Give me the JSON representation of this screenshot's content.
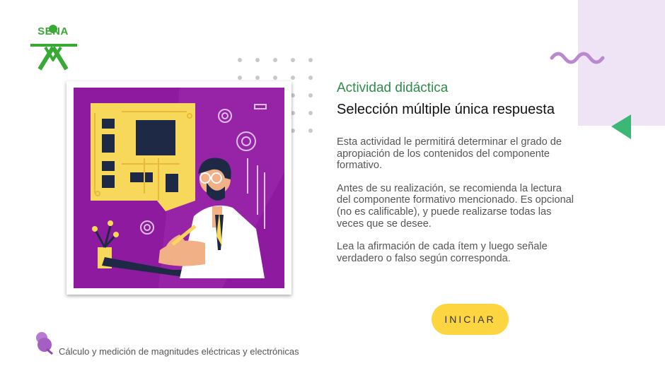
{
  "logo": {
    "text": "SENA"
  },
  "activity": {
    "subtitle": "Actividad didáctica",
    "title": "Selección múltiple única respuesta",
    "paragraphs": [
      "Esta actividad le permitirá determinar el grado de apropiación de los contenidos del componente formativo.",
      "Antes de su realización, se recomienda la lectura del componente formativo mencionado. Es opcional (no es calificable), y puede realizarse todas las veces que se desee.",
      "Lea la afirmación de cada ítem y luego señale verdadero o falso según corresponda."
    ],
    "start_label": "INICIAR"
  },
  "footer": {
    "course": "Cálculo y medición de magnitudes eléctricas y electrónicas"
  },
  "colors": {
    "green": "#39a935",
    "purple": "#8e1a9f",
    "yellow": "#fcd541",
    "lilac": "#efe4f5",
    "triangle": "#3db776"
  },
  "icons": [
    "sena-logo-icon",
    "wave-decoration-icon",
    "triangle-pointer-icon",
    "pushpin-icon"
  ]
}
